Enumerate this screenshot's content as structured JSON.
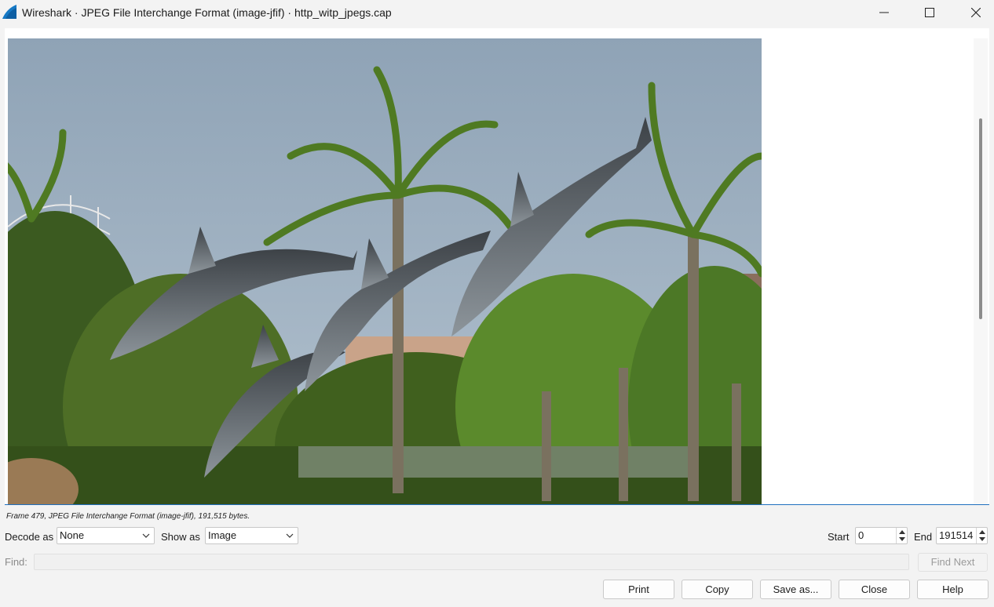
{
  "window": {
    "title": "Wireshark · JPEG File Interchange Format (image-jfif) · http_witp_jpegs.cap",
    "controls": {
      "minimize": "minimize-icon",
      "maximize": "maximize-icon",
      "close": "close-icon"
    }
  },
  "frame_info": "Frame 479, JPEG File Interchange Format (image-jfif), 191,515 bytes.",
  "decode": {
    "label": "Decode as",
    "value": "None"
  },
  "show": {
    "label": "Show as",
    "value": "Image"
  },
  "start": {
    "label": "Start",
    "value": "0"
  },
  "end": {
    "label": "End",
    "value": "191514"
  },
  "find": {
    "label": "Find:",
    "value": "",
    "next_label": "Find Next"
  },
  "buttons": {
    "print": "Print",
    "copy": "Copy",
    "save_as": "Save as...",
    "close": "Close",
    "help": "Help"
  },
  "colors": {
    "accent": "#1f6fbf",
    "window_bg": "#f3f3f3",
    "sky": "#9fb3c4"
  }
}
